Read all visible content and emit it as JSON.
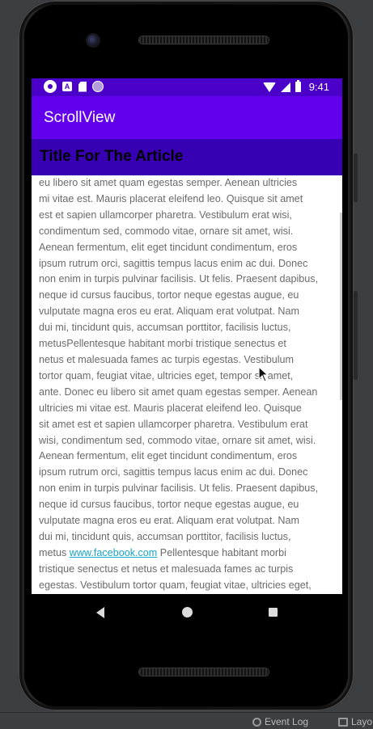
{
  "status_bar": {
    "time": "9:41",
    "icons": [
      "gear-icon",
      "a-icon",
      "sd-card-icon",
      "circle-app-icon",
      "wifi-icon",
      "signal-icon",
      "battery-icon"
    ]
  },
  "app_bar": {
    "title": "ScrollView"
  },
  "article": {
    "title": "Title For The Article",
    "lines": [
      "eu libero sit amet quam egestas semper. Aenean ultricies",
      "mi vitae est. Mauris placerat eleifend leo. Quisque sit amet",
      "est et sapien ullamcorper pharetra. Vestibulum erat wisi,",
      "condimentum sed, commodo vitae, ornare sit amet, wisi.",
      "Aenean fermentum, elit eget tincidunt condimentum, eros",
      "ipsum rutrum orci, sagittis tempus lacus enim ac dui. Donec",
      "non enim in turpis pulvinar facilisis. Ut felis. Praesent dapibus,",
      "neque id cursus faucibus, tortor neque egestas augue, eu",
      "vulputate magna eros eu erat. Aliquam erat volutpat. Nam",
      "dui mi, tincidunt quis, accumsan porttitor, facilisis luctus,",
      "metusPellentesque habitant morbi tristique senectus et",
      "netus et malesuada fames ac turpis egestas. Vestibulum",
      "tortor quam, feugiat vitae, ultricies eget, tempor sit amet,",
      "ante. Donec eu libero sit amet quam egestas semper. Aenean",
      "ultricies mi vitae est. Mauris placerat eleifend leo. Quisque",
      "sit amet est et sapien ullamcorper pharetra. Vestibulum erat",
      "wisi, condimentum sed, commodo vitae, ornare sit amet, wisi.",
      "Aenean fermentum, elit eget tincidunt condimentum, eros",
      "ipsum rutrum orci, sagittis tempus lacus enim ac dui. Donec",
      "non enim in turpis pulvinar facilisis. Ut felis. Praesent dapibus,",
      "neque id cursus faucibus, tortor neque egestas augue, eu",
      "vulputate magna eros eu erat. Aliquam erat volutpat. Nam",
      "dui mi, tincidunt quis, accumsan porttitor, facilisis luctus,"
    ],
    "link_line_prefix": "metus ",
    "link_text": "www.facebook.com",
    "link_line_suffix": " Pellentesque habitant morbi",
    "lines_after": [
      "tristique senectus et netus et malesuada fames ac turpis",
      "egestas. Vestibulum tortor quam, feugiat vitae, ultricies eget,"
    ]
  },
  "nav_bar": {
    "icons": [
      "back-icon",
      "home-icon",
      "recents-icon"
    ]
  },
  "ide_status": {
    "event_log": "Event Log",
    "layout": "Layo"
  },
  "colors": {
    "status_bar": "#4a00c8",
    "app_bar": "#6200ee",
    "article_header": "#3700b3",
    "body_text": "#6b6b6b",
    "link": "#1aa4c8"
  }
}
